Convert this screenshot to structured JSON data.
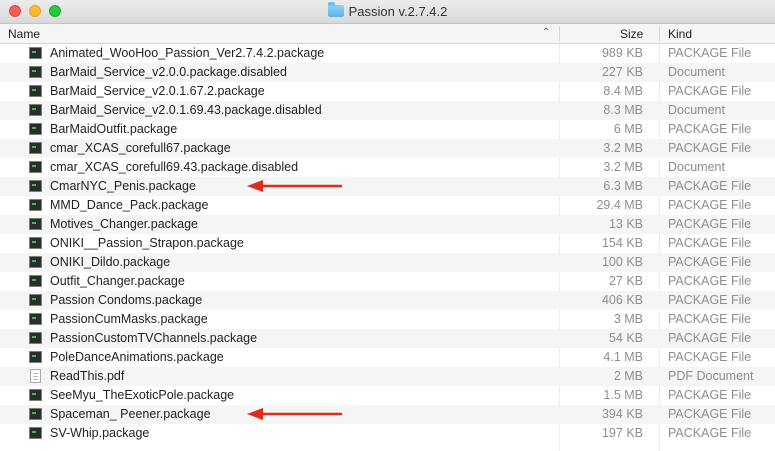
{
  "window": {
    "title": "Passion v.2.7.4.2",
    "folder_icon": "folder-icon"
  },
  "header": {
    "name": "Name",
    "size": "Size",
    "kind": "Kind",
    "sort_indicator": "^"
  },
  "files": [
    {
      "name": "Animated_WooHoo_Passion_Ver2.7.4.2.package",
      "size": "989 KB",
      "kind": "PACKAGE File",
      "icon": "package-file-icon",
      "marked": false
    },
    {
      "name": "BarMaid_Service_v2.0.0.package.disabled",
      "size": "227 KB",
      "kind": "Document",
      "icon": "package-file-icon",
      "marked": false
    },
    {
      "name": "BarMaid_Service_v2.0.1.67.2.package",
      "size": "8.4 MB",
      "kind": "PACKAGE File",
      "icon": "package-file-icon",
      "marked": false
    },
    {
      "name": "BarMaid_Service_v2.0.1.69.43.package.disabled",
      "size": "8.3 MB",
      "kind": "Document",
      "icon": "package-file-icon",
      "marked": false
    },
    {
      "name": "BarMaidOutfit.package",
      "size": "6 MB",
      "kind": "PACKAGE File",
      "icon": "package-file-icon",
      "marked": false
    },
    {
      "name": "cmar_XCAS_corefull67.package",
      "size": "3.2 MB",
      "kind": "PACKAGE File",
      "icon": "package-file-icon",
      "marked": false
    },
    {
      "name": "cmar_XCAS_corefull69.43.package.disabled",
      "size": "3.2 MB",
      "kind": "Document",
      "icon": "package-file-icon",
      "marked": false
    },
    {
      "name": "CmarNYC_Penis.package",
      "size": "6.3 MB",
      "kind": "PACKAGE File",
      "icon": "package-file-icon",
      "marked": true
    },
    {
      "name": "MMD_Dance_Pack.package",
      "size": "29.4 MB",
      "kind": "PACKAGE File",
      "icon": "package-file-icon",
      "marked": false
    },
    {
      "name": "Motives_Changer.package",
      "size": "13 KB",
      "kind": "PACKAGE File",
      "icon": "package-file-icon",
      "marked": false
    },
    {
      "name": "ONIKI__Passion_Strapon.package",
      "size": "154 KB",
      "kind": "PACKAGE File",
      "icon": "package-file-icon",
      "marked": false
    },
    {
      "name": "ONIKI_Dildo.package",
      "size": "100 KB",
      "kind": "PACKAGE File",
      "icon": "package-file-icon",
      "marked": false
    },
    {
      "name": "Outfit_Changer.package",
      "size": "27 KB",
      "kind": "PACKAGE File",
      "icon": "package-file-icon",
      "marked": false
    },
    {
      "name": "Passion Condoms.package",
      "size": "406 KB",
      "kind": "PACKAGE File",
      "icon": "package-file-icon",
      "marked": false
    },
    {
      "name": "PassionCumMasks.package",
      "size": "3 MB",
      "kind": "PACKAGE File",
      "icon": "package-file-icon",
      "marked": false
    },
    {
      "name": "PassionCustomTVChannels.package",
      "size": "54 KB",
      "kind": "PACKAGE File",
      "icon": "package-file-icon",
      "marked": false
    },
    {
      "name": "PoleDanceAnimations.package",
      "size": "4.1 MB",
      "kind": "PACKAGE File",
      "icon": "package-file-icon",
      "marked": false
    },
    {
      "name": "ReadThis.pdf",
      "size": "2 MB",
      "kind": "PDF Document",
      "icon": "pdf-document-icon",
      "marked": false
    },
    {
      "name": "SeeMyu_TheExoticPole.package",
      "size": "1.5 MB",
      "kind": "PACKAGE File",
      "icon": "package-file-icon",
      "marked": false
    },
    {
      "name": "Spaceman_ Peener.package",
      "size": "394 KB",
      "kind": "PACKAGE File",
      "icon": "package-file-icon",
      "marked": true
    },
    {
      "name": "SV-Whip.package",
      "size": "197 KB",
      "kind": "PACKAGE File",
      "icon": "package-file-icon",
      "marked": false
    }
  ],
  "colors": {
    "arrow": "#e0291f",
    "row_alt": "#f4f5f5",
    "secondary_text": "#8e8e8e"
  }
}
